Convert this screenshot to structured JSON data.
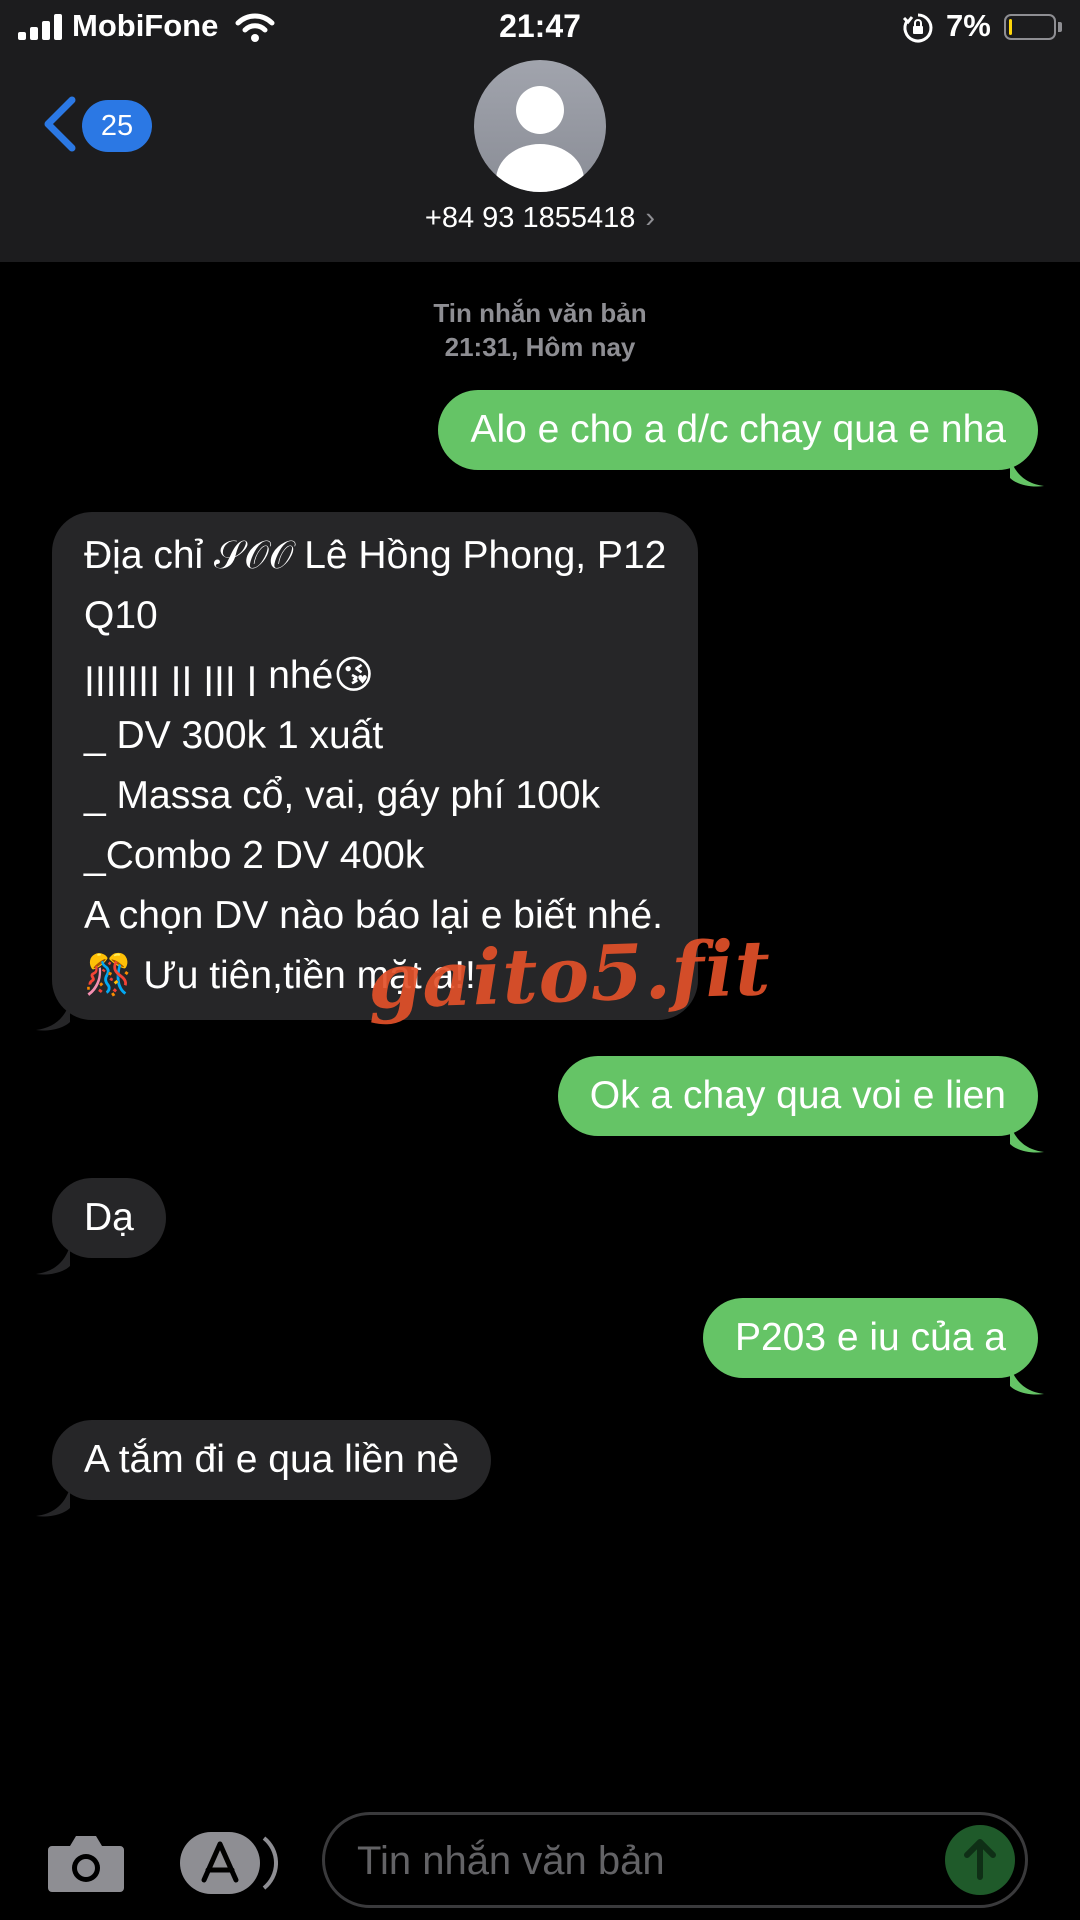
{
  "status_bar": {
    "carrier": "MobiFone",
    "time": "21:47",
    "battery_percent": "7%",
    "battery_level": 0.07,
    "battery_color": "#ffd60a"
  },
  "header": {
    "back_count": "25",
    "contact": "+84 93 1855418",
    "chevron": "›",
    "accent_color": "#2b78e4"
  },
  "thread": {
    "type": "Tin nhắn văn bản",
    "timestamp": "21:31, Hôm nay"
  },
  "messages": [
    {
      "direction": "out",
      "lines": [
        "Alo e cho a d/c chay qua e nha"
      ]
    },
    {
      "direction": "in",
      "lines": [
        "Địa chỉ 𝒮𝒪𝒪 Lê Hồng Phong, P12",
        "Q10",
        "ꞁꞁꞁꞁꞁꞁꞁ ꞁꞁ ꞁꞁꞁ ꞁ nhé😘",
        "_ DV 300k 1 xuất",
        "_ Massa cổ, vai, gáy phí 100k",
        "_Combo 2 DV 400k",
        "A chọn DV nào báo lại e biết nhé.",
        "🎊 Ưu tiên,tiền mặt a!!"
      ]
    },
    {
      "direction": "out",
      "lines": [
        "Ok a chay qua voi e lien"
      ]
    },
    {
      "direction": "in",
      "lines": [
        "Dạ"
      ]
    },
    {
      "direction": "out",
      "lines": [
        "P203 e iu của a"
      ]
    },
    {
      "direction": "in",
      "lines": [
        "A tắm đi e qua liền nè"
      ]
    }
  ],
  "watermark": "gaito5.fit",
  "compose": {
    "placeholder": "Tin nhắn văn bản"
  },
  "colors": {
    "outgoing_bubble": "#65c466",
    "incoming_bubble": "#262628",
    "header_bg": "#1c1c1e"
  },
  "icons": [
    "signal-icon",
    "wifi-icon",
    "rotation-lock-icon",
    "battery-icon",
    "back-chevron-icon",
    "avatar-icon",
    "camera-icon",
    "app-store-icon",
    "send-arrow-icon"
  ]
}
